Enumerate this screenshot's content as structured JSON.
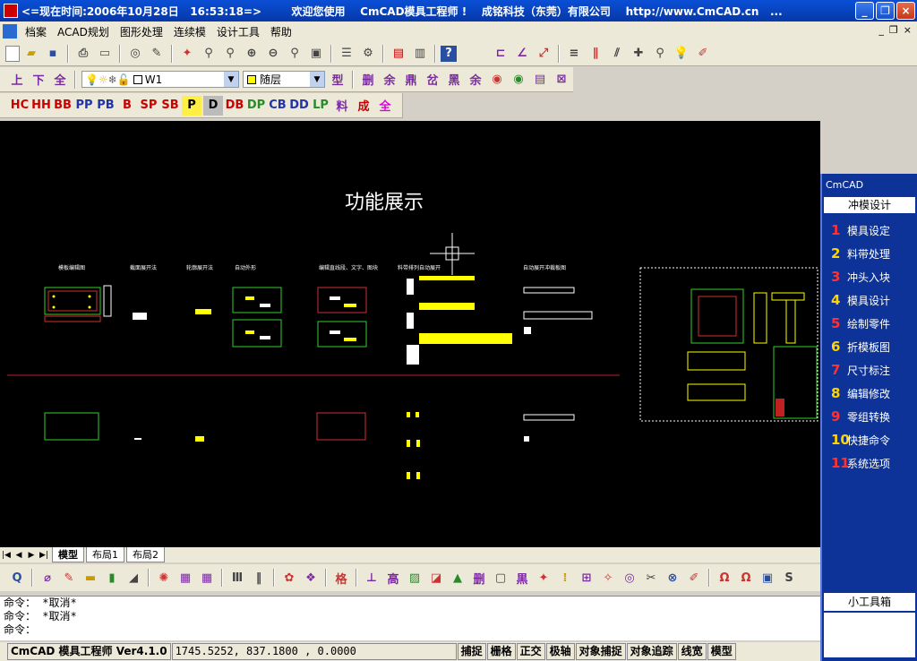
{
  "title": {
    "text": "<=现在时间:2006年10月28日   16:53:18=>        欢迎您使用    CmCAD模具工程师 !    成铭科技（东莞）有限公司    http://www.CmCAD.cn   ..."
  },
  "menu": [
    "档案",
    "ACAD规划",
    "图形处理",
    "连续模",
    "设计工具",
    "帮助"
  ],
  "mdi_controls": [
    "_",
    "❐",
    "×"
  ],
  "toolbar2": {
    "labels": [
      "上",
      "下",
      "全"
    ],
    "layer_combo": "W1",
    "color_combo": "随层"
  },
  "toolbar3": [
    "HC",
    "HH",
    "BB",
    "PP",
    "PB",
    "B",
    "SP",
    "SB",
    "P",
    "D",
    "DB",
    "DP",
    "CB",
    "DD",
    "LP",
    "料",
    "成",
    "全"
  ],
  "canvas": {
    "heading": "功能展示",
    "labels": [
      "模板编辑图",
      "截面展开法",
      "轮廓展开法",
      "自动外形",
      "编辑直线段、文字、图块",
      "料带排列自动展开",
      "自动展开冲裁板图"
    ]
  },
  "tabs": [
    "模型",
    "布局1",
    "布局2"
  ],
  "command": {
    "lines": [
      "命令： *取消*",
      "命令： *取消*",
      "命令："
    ]
  },
  "status": {
    "app": "CmCAD 模具工程师 Ver4.1.0",
    "coords": "1745.5252, 837.1800 , 0.0000",
    "toggles": [
      "捕捉",
      "栅格",
      "正交",
      "极轴",
      "对象捕捉",
      "对象追踪",
      "线宽",
      "模型"
    ]
  },
  "panel": {
    "header": "CmCAD",
    "section": "冲模设计",
    "items": [
      {
        "num": "1",
        "label": "模具设定",
        "red": true
      },
      {
        "num": "2",
        "label": "料带处理",
        "red": false
      },
      {
        "num": "3",
        "label": "冲头入块",
        "red": true
      },
      {
        "num": "4",
        "label": "模具设计",
        "red": false
      },
      {
        "num": "5",
        "label": "绘制零件",
        "red": true
      },
      {
        "num": "6",
        "label": "折模板图",
        "red": false
      },
      {
        "num": "7",
        "label": "尺寸标注",
        "red": true
      },
      {
        "num": "8",
        "label": "编辑修改",
        "red": false
      },
      {
        "num": "9",
        "label": "零组转换",
        "red": true
      },
      {
        "num": "10",
        "label": "快捷命令",
        "red": false
      },
      {
        "num": "11",
        "label": "系统选项",
        "red": true
      }
    ],
    "footer": "小工具箱"
  }
}
